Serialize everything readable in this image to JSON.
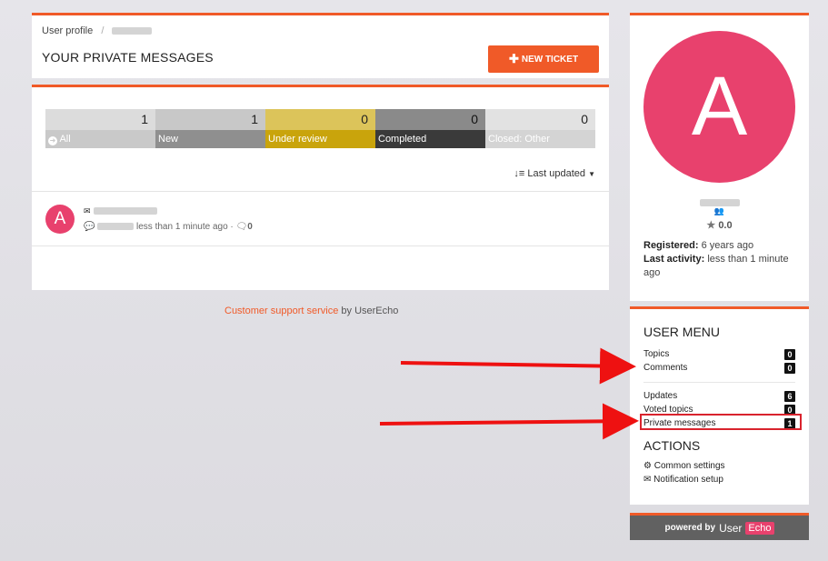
{
  "header": {
    "breadcrumb_root": "User profile",
    "breadcrumb_sep": "/",
    "page_title": "YOUR PRIVATE MESSAGES",
    "new_ticket_label": "NEW TICKET",
    "new_ticket_icon": "plus-icon"
  },
  "stats": [
    {
      "label": "All",
      "count": "1",
      "icon": "arrow-circle-icon"
    },
    {
      "label": "New",
      "count": "1"
    },
    {
      "label": "Under review",
      "count": "0"
    },
    {
      "label": "Completed",
      "count": "0"
    },
    {
      "label": "Closed: Other",
      "count": "0"
    }
  ],
  "sort": {
    "label": "Last updated",
    "icon": "sort-icon"
  },
  "message": {
    "avatar_letter": "A",
    "time": "less than 1 minute ago",
    "comment_count": "0",
    "separator": "·"
  },
  "footer": {
    "link_text": "Customer support service",
    "by_text": "by UserEcho"
  },
  "profile": {
    "avatar_letter": "A",
    "rating": "0.0",
    "registered_label": "Registered:",
    "registered_value": "6 years ago",
    "last_activity_label": "Last activity:",
    "last_activity_value": "less than 1 minute ago"
  },
  "user_menu": {
    "title": "USER MENU",
    "items_group1": [
      {
        "label": "Topics",
        "count": "0"
      },
      {
        "label": "Comments",
        "count": "0"
      }
    ],
    "items_group2": [
      {
        "label": "Updates",
        "count": "6"
      },
      {
        "label": "Voted topics",
        "count": "0"
      },
      {
        "label": "Private messages",
        "count": "1"
      }
    ]
  },
  "actions": {
    "title": "ACTIONS",
    "items": [
      {
        "label": "Common settings",
        "icon": "gear-icon"
      },
      {
        "label": "Notification setup",
        "icon": "envelope-icon"
      }
    ]
  },
  "powered_by": {
    "text": "powered by",
    "brand_user": "User",
    "brand_echo": "Echo"
  },
  "colors": {
    "accent": "#f05a28",
    "avatar": "#e8416d",
    "annotation_red": "#d9232d"
  }
}
